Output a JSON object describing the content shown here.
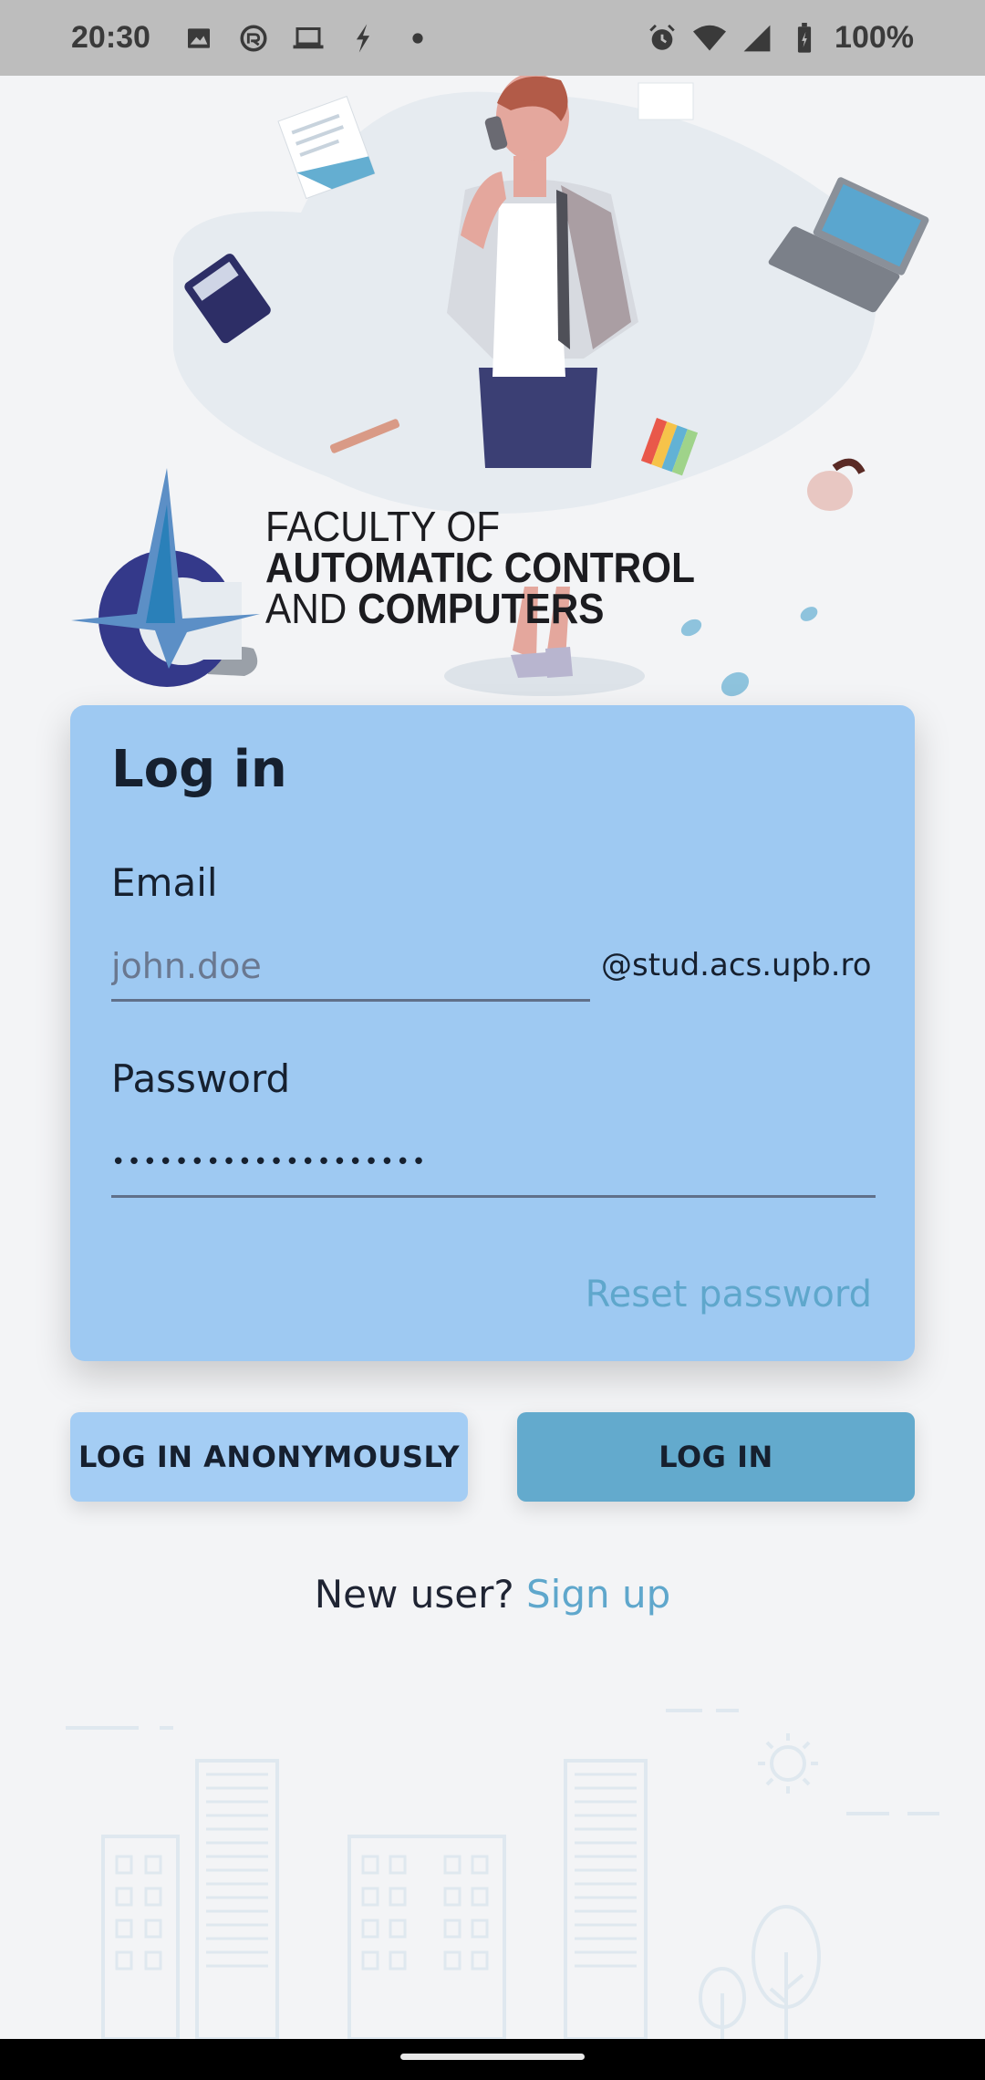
{
  "status_bar": {
    "time": "20:30",
    "battery": "100%",
    "left_icons": [
      "image-icon",
      "vpn-icon",
      "laptop-icon",
      "flash-icon",
      "dot-icon"
    ],
    "right_icons": [
      "alarm-icon",
      "wifi-icon",
      "signal-icon",
      "battery-icon"
    ]
  },
  "branding": {
    "line1": "FACULTY OF",
    "line2": "AUTOMATIC CONTROL",
    "line3_light": "AND ",
    "line3_bold": "COMPUTERS"
  },
  "login_card": {
    "title": "Log in",
    "email_label": "Email",
    "email_placeholder": "john.doe",
    "email_value": "",
    "email_domain": "@stud.acs.upb.ro",
    "password_label": "Password",
    "password_value": "••••••••••••••••••••",
    "reset_password": "Reset password"
  },
  "buttons": {
    "anonymous": "LOG IN ANONYMOUSLY",
    "login": "LOG IN"
  },
  "signup": {
    "prompt": "New user? ",
    "link": "Sign up"
  },
  "colors": {
    "card_bg": "#9ec9f2",
    "primary_button": "#63aacd",
    "secondary_button": "#a4cdf4",
    "link": "#5fa7cc",
    "page_bg": "#f3f4f6"
  }
}
